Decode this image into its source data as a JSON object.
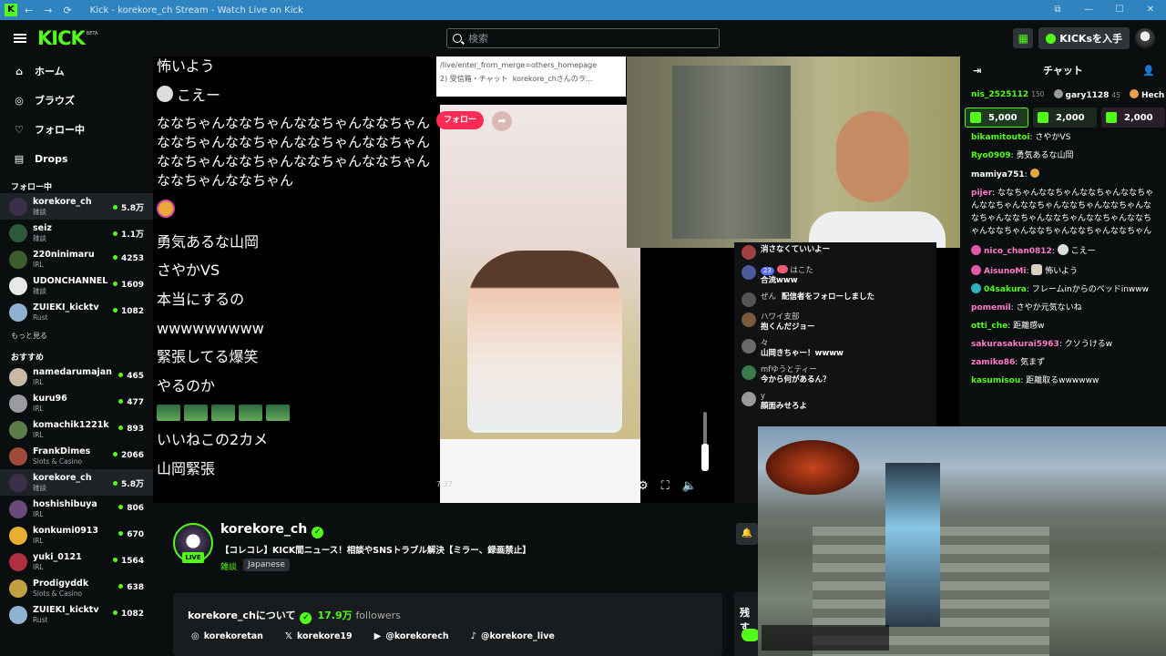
{
  "window": {
    "title": "Kick - korekore_ch Stream - Watch Live on Kick",
    "back": "←",
    "forward": "→",
    "reload": "⟳",
    "controls": [
      "⧉",
      "—",
      "☐",
      "✕"
    ]
  },
  "topnav": {
    "logo": "KICK",
    "beta": "BETA",
    "search_placeholder": "検索",
    "kicks_button": "KICKsを入手"
  },
  "sidebar": {
    "nav": [
      {
        "label": "ホーム",
        "icon": "home-icon",
        "glyph": "⌂"
      },
      {
        "label": "ブラウズ",
        "icon": "compass-icon",
        "glyph": "◎"
      },
      {
        "label": "フォロー中",
        "icon": "heart-icon",
        "glyph": "♡"
      },
      {
        "label": "Drops",
        "icon": "drops-icon",
        "glyph": "▤"
      }
    ],
    "following_title": "フォロー中",
    "following": [
      {
        "name": "korekore_ch",
        "category": "雑談",
        "viewers": "5.8万",
        "color": "#3c2f4a",
        "active": true
      },
      {
        "name": "seiz",
        "category": "雑談",
        "viewers": "1.1万",
        "color": "#2d5a3a"
      },
      {
        "name": "220ninimaru",
        "category": "IRL",
        "viewers": "4253",
        "color": "#3b5e2b"
      },
      {
        "name": "UDONCHANNEL",
        "category": "雑談",
        "viewers": "1609",
        "color": "#e8e8e8"
      },
      {
        "name": "ZUIEKI_kicktv",
        "category": "Rust",
        "viewers": "1082",
        "color": "#8fb2d0"
      }
    ],
    "more_label": "もっと見る",
    "recommended_title": "おすすめ",
    "recommended": [
      {
        "name": "namedarumajan",
        "category": "IRL",
        "viewers": "465",
        "color": "#c9b8a6"
      },
      {
        "name": "kuru96",
        "category": "IRL",
        "viewers": "477",
        "color": "#9a9aa0"
      },
      {
        "name": "komachik1221k",
        "category": "IRL",
        "viewers": "893",
        "color": "#5c7a4a"
      },
      {
        "name": "FrankDimes",
        "category": "Slots & Casino",
        "viewers": "2066",
        "color": "#a04a3a"
      },
      {
        "name": "korekore_ch",
        "category": "雑談",
        "viewers": "5.8万",
        "color": "#3c2f4a",
        "active": true
      },
      {
        "name": "hoshishibuya",
        "category": "IRL",
        "viewers": "806",
        "color": "#6a4a7a"
      },
      {
        "name": "konkumi0913",
        "category": "IRL",
        "viewers": "670",
        "color": "#e8b030"
      },
      {
        "name": "yuki_0121",
        "category": "IRL",
        "viewers": "1564",
        "color": "#b03040"
      },
      {
        "name": "Prodigyddk",
        "category": "Slots & Casino",
        "viewers": "638",
        "color": "#c0a040"
      },
      {
        "name": "ZUIEKI_kicktv",
        "category": "Rust",
        "viewers": "1082",
        "color": "#8fb2d0"
      }
    ]
  },
  "overlay_chat": {
    "lines": [
      "怖いよう",
      "こえー",
      "ななちゃんななちゃんななちゃんななちゃんななちゃんななちゃんななちゃんななちゃんななちゃんななちゃんななちゃんななちゃんななちゃんななちゃん",
      "勇気あるな山岡",
      "さやかVS",
      "本当にするの",
      "wwwwwwwww",
      "緊張してる爆笑",
      "やるのか",
      "いいねこの2カメ",
      "山岡緊張"
    ]
  },
  "tiktok": {
    "url_text": "/live/enter_from_merge=others_homepage",
    "tab_text": "2) 受信箱・チャット",
    "tab_text2": "korekore_chさんのラ...",
    "follow_label": "フォロー",
    "timestamp": "7:37",
    "chat": [
      {
        "name": "",
        "msg": "消さなくていいよー",
        "color": "#a04040"
      },
      {
        "name": "はこた",
        "badge": "23",
        "msg": "合流www",
        "color": "#4a5a9a"
      },
      {
        "name": "ぜん",
        "msg": "配信者をフォローしました",
        "system": true,
        "color": "#555"
      },
      {
        "name": "ハワイ支部",
        "msg": "抱くんだジョー",
        "color": "#7a5a3a"
      },
      {
        "name": "々",
        "msg": "山岡きちゃー！wwww",
        "color": "#6a6a6a"
      },
      {
        "name": "mfゆうとティー",
        "msg": "今から何があるん？",
        "color": "#3a7a4a"
      },
      {
        "name": "y",
        "msg": "顔面みせろよ",
        "color": "#9a9a9a"
      }
    ]
  },
  "stream_info": {
    "channel": "korekore_ch",
    "live_badge": "LIVE",
    "title": "【コレコレ】KICK間ニュース！相談やSNSトラブル解決【ミラー、録画禁止】",
    "category": "雑談",
    "language": "Japanese",
    "about_label": "korekore_chについて",
    "followers_count": "17.9万",
    "followers_label": "followers",
    "socials": [
      {
        "icon": "instagram-icon",
        "glyph": "◎",
        "handle": "korekoretan"
      },
      {
        "icon": "x-icon",
        "glyph": "𝕏",
        "handle": "korekore19"
      },
      {
        "icon": "youtube-icon",
        "glyph": "▶",
        "handle": "@korekorech"
      },
      {
        "icon": "tiktok-icon",
        "glyph": "♪",
        "handle": "@korekore_live"
      }
    ],
    "cut_label": "残す"
  },
  "chat": {
    "header": "チャット",
    "gifters": [
      {
        "name": "nis_2525112",
        "amount": "150"
      },
      {
        "name": "gary1128",
        "amount": "45"
      },
      {
        "name": "Hech",
        "amount": ""
      }
    ],
    "pinned": [
      "5,000",
      "2,000",
      "2,000"
    ],
    "messages": [
      {
        "user": "bikamitoutoi",
        "text": "さやかVS",
        "color": "#53fc18"
      },
      {
        "user": "Ryo0909",
        "text": "勇気あるな山岡",
        "color": "#53fc18"
      },
      {
        "user": "mamiya751",
        "text": "",
        "color": "#ffffff",
        "emoji": "laugh"
      },
      {
        "user": "pijer",
        "text": "ななちゃんななちゃんななちゃんななちゃんななちゃんななちゃんななちゃんななちゃんななちゃんななちゃんななちゃんななちゃんななちゃんななちゃんななちゃんななちゃんななちゃん",
        "color": "#ff7ac8"
      },
      {
        "user": "nico_chan0812",
        "text": "こえー",
        "color": "#ff7ac8",
        "badge": "pink",
        "emoji": "skull"
      },
      {
        "user": "AisunoMi",
        "text": "怖いよう",
        "color": "#ff7ac8",
        "badge": "pink",
        "emoji": "ai"
      },
      {
        "user": "04sakura",
        "text": "フレームinからのベッドinwww",
        "color": "#53fc18",
        "badge": "cyan"
      },
      {
        "user": "pomemil",
        "text": "さやか元気ないね",
        "color": "#ff7ac8"
      },
      {
        "user": "otti_che",
        "text": "距離感w",
        "color": "#53fc18"
      },
      {
        "user": "sakurasakurai5963",
        "text": "クソうけるw",
        "color": "#ff7ac8"
      },
      {
        "user": "zamiko86",
        "text": "気まず",
        "color": "#ff7ac8"
      },
      {
        "user": "kasumisou",
        "text": "距離取るwwwwww",
        "color": "#53fc18"
      }
    ]
  },
  "colors": {
    "accent": "#53fc18",
    "bg": "#0b0e0f"
  }
}
